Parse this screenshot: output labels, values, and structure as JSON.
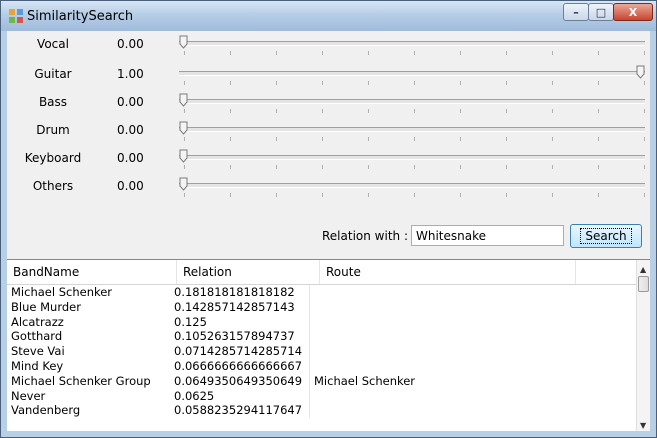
{
  "window": {
    "title": "SimilaritySearch",
    "minimize": "–",
    "maximize": "□",
    "close": "X"
  },
  "sliders": [
    {
      "label": "Vocal",
      "value": "0.00",
      "level": 0
    },
    {
      "label": "Guitar",
      "value": "1.00",
      "level": 1
    },
    {
      "label": "Bass",
      "value": "0.00",
      "level": 0
    },
    {
      "label": "Drum",
      "value": "0.00",
      "level": 0
    },
    {
      "label": "Keyboard",
      "value": "0.00",
      "level": 0
    },
    {
      "label": "Others",
      "value": "0.00",
      "level": 0
    }
  ],
  "relation": {
    "label": "Relation with :",
    "value": "Whitesnake",
    "button": "Search"
  },
  "grid": {
    "headers": [
      "BandName",
      "Relation",
      "Route"
    ],
    "rows": [
      [
        "Michael Schenker",
        "0.181818181818182",
        ""
      ],
      [
        "Blue Murder",
        "0.142857142857143",
        ""
      ],
      [
        "Alcatrazz",
        "0.125",
        ""
      ],
      [
        "Gotthard",
        "0.105263157894737",
        ""
      ],
      [
        "Steve Vai",
        "0.0714285714285714",
        ""
      ],
      [
        "Mind Key",
        "0.0666666666666667",
        ""
      ],
      [
        "Michael Schenker Group",
        "0.0649350649350649",
        "Michael Schenker"
      ],
      [
        "Never",
        "0.0625",
        ""
      ],
      [
        "Vandenberg",
        "0.0588235294117647",
        ""
      ]
    ]
  }
}
